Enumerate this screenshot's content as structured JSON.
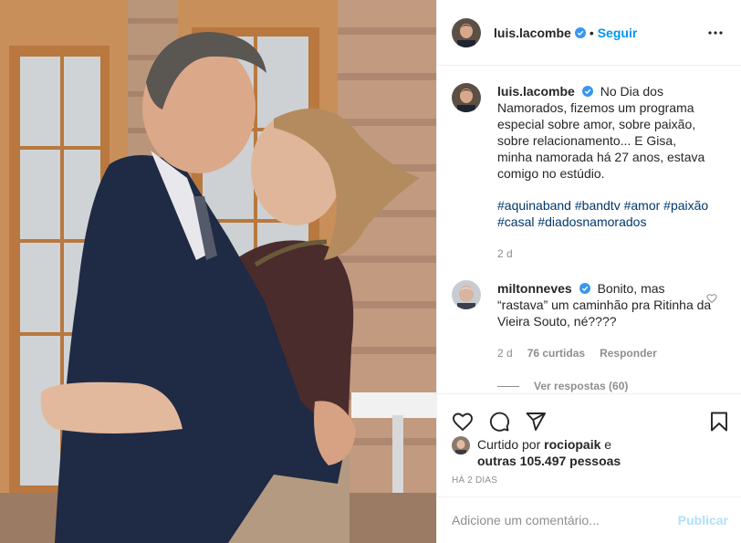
{
  "post": {
    "author": "luis.lacombe",
    "follow_label": "Seguir",
    "separator": "•",
    "caption_text": "No Dia dos Namorados, fizemos um programa especial sobre amor, sobre paixão, sobre relacionamento... E Gisa, minha namorada há 27 anos, estava comigo no estúdio.",
    "hashtags": [
      "#aquinaband",
      "#bandtv",
      "#amor",
      "#paixão",
      "#casal",
      "#diadosnamorados"
    ],
    "caption_age": "2 d"
  },
  "comment": {
    "author": "miltonneves",
    "text": "Bonito, mas “rastava” um caminhão pra Ritinha da Vieira Souto, né????",
    "age": "2 d",
    "likes": "76 curtidas",
    "reply_label": "Responder",
    "view_replies": "Ver respostas (60)"
  },
  "likes": {
    "prefix": "Curtido por",
    "user": "rociopaik",
    "conjunction": "e",
    "others": "outras 105.497 pessoas"
  },
  "timestamp": "HÁ 2 DIAS",
  "add_comment": {
    "placeholder": "Adicione um comentário...",
    "publish_label": "Publicar"
  },
  "colors": {
    "accent": "#0095f6",
    "hashtag": "#00376b",
    "muted": "#8e8e8e",
    "publish_disabled": "#b2dffc"
  },
  "icons": [
    "verified-icon",
    "more-options-icon",
    "heart-icon",
    "comment-icon",
    "share-icon",
    "bookmark-icon"
  ]
}
